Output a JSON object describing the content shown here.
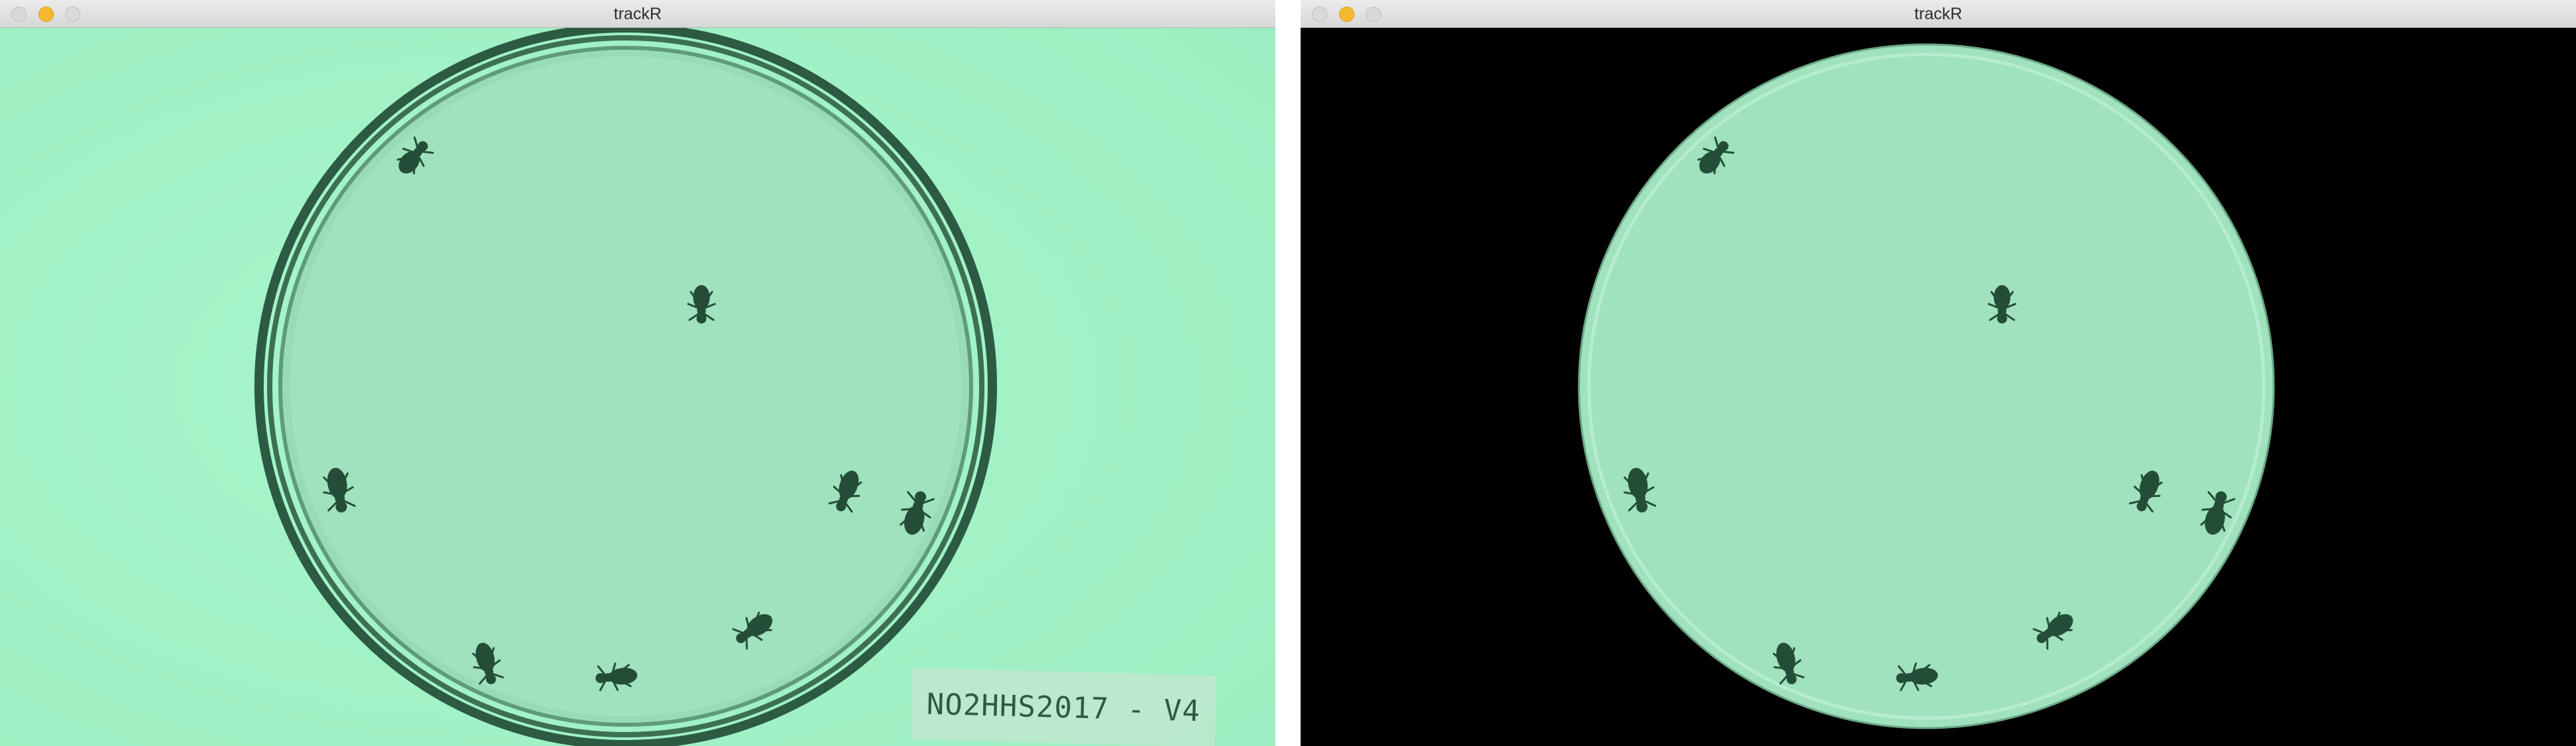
{
  "windows": [
    {
      "title": "trackR",
      "traffic_lights": {
        "close": {
          "color": "#d9d9d9",
          "icon": "close-icon"
        },
        "minimize": {
          "color": "#f5b92f",
          "icon": "minimize-icon"
        },
        "zoom": {
          "color": "#d9d9d9",
          "icon": "zoom-icon"
        }
      },
      "view": "raw-frame",
      "arena_label": "NO2HHS2017 - V4",
      "ant_count": 8
    },
    {
      "title": "trackR",
      "traffic_lights": {
        "close": {
          "color": "#d9d9d9",
          "icon": "close-icon"
        },
        "minimize": {
          "color": "#f5b92f",
          "icon": "minimize-icon"
        },
        "zoom": {
          "color": "#d9d9d9",
          "icon": "zoom-icon"
        }
      },
      "view": "masked-frame",
      "ant_count": 8
    }
  ],
  "colors": {
    "background_green": "#a4f5c8",
    "arena_green": "#9fe2bd",
    "ant_dark": "#1f4a35",
    "mask_black": "#000000"
  }
}
